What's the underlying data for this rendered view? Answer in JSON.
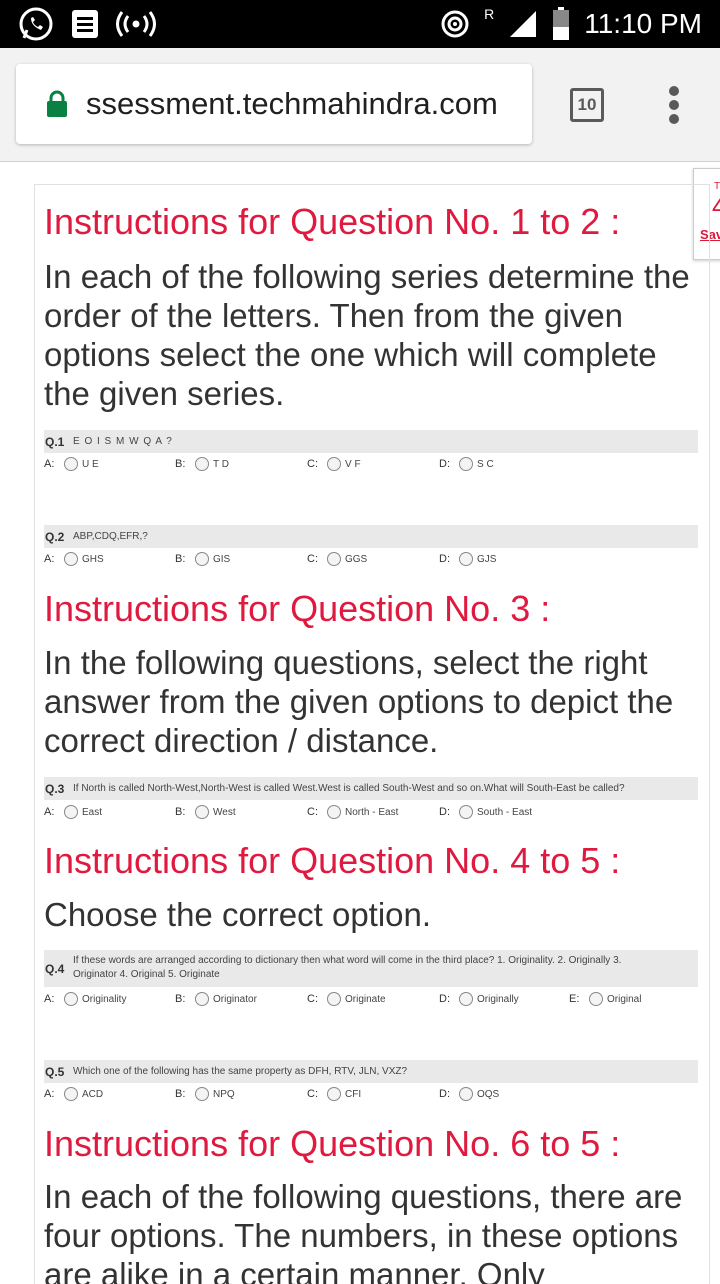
{
  "status": {
    "time": "11:10 PM",
    "roaming": "R"
  },
  "browser": {
    "url": "ssessment.techmahindra.com",
    "tab_count": "10"
  },
  "side_tab": {
    "t1": "T",
    "t2": "4",
    "save": "Sav"
  },
  "sections": [
    {
      "title": "Instructions for Question No. 1 to 2 :",
      "body": "In each of the following series determine the order of the letters. Then from the given options select the one which will complete the given series."
    },
    {
      "title": "Instructions for Question No. 3 :",
      "body": "In the following questions, select the right answer from the given options to depict the correct direction / distance."
    },
    {
      "title": "Instructions for Question No. 4 to 5 :",
      "body": "Choose the correct option."
    },
    {
      "title": "Instructions for Question No. 6 to 5 :",
      "body": "In each of the following questions, there are four options. The numbers, in these options are alike in a certain manner. Only"
    }
  ],
  "questions": [
    {
      "num": "Q.1",
      "text": "E O I S M W Q A ?",
      "options": [
        {
          "letter": "A:",
          "text": "U E"
        },
        {
          "letter": "B:",
          "text": "T D"
        },
        {
          "letter": "C:",
          "text": "V F"
        },
        {
          "letter": "D:",
          "text": "S C"
        }
      ]
    },
    {
      "num": "Q.2",
      "text": "ABP,CDQ,EFR,?",
      "options": [
        {
          "letter": "A:",
          "text": "GHS"
        },
        {
          "letter": "B:",
          "text": "GIS"
        },
        {
          "letter": "C:",
          "text": "GGS"
        },
        {
          "letter": "D:",
          "text": "GJS"
        }
      ]
    },
    {
      "num": "Q.3",
      "text": "If North is called North-West,North-West is called West.West is called South-West and so on.What will South-East be called?",
      "options": [
        {
          "letter": "A:",
          "text": "East"
        },
        {
          "letter": "B:",
          "text": "West"
        },
        {
          "letter": "C:",
          "text": "North - East"
        },
        {
          "letter": "D:",
          "text": "South - East"
        }
      ]
    },
    {
      "num": "Q.4",
      "text": "If these words are arranged according to dictionary then what word will come in the third place? 1. Originality. 2. Originally 3. Originator 4. Original 5. Originate",
      "options": [
        {
          "letter": "A:",
          "text": "Originality"
        },
        {
          "letter": "B:",
          "text": "Originator"
        },
        {
          "letter": "C:",
          "text": "Originate"
        },
        {
          "letter": "D:",
          "text": "Originally"
        },
        {
          "letter": "E:",
          "text": "Original"
        }
      ]
    },
    {
      "num": "Q.5",
      "text": "Which one of the following has the same property as DFH, RTV, JLN, VXZ?",
      "options": [
        {
          "letter": "A:",
          "text": "ACD"
        },
        {
          "letter": "B:",
          "text": "NPQ"
        },
        {
          "letter": "C:",
          "text": "CFI"
        },
        {
          "letter": "D:",
          "text": "OQS"
        }
      ]
    }
  ]
}
